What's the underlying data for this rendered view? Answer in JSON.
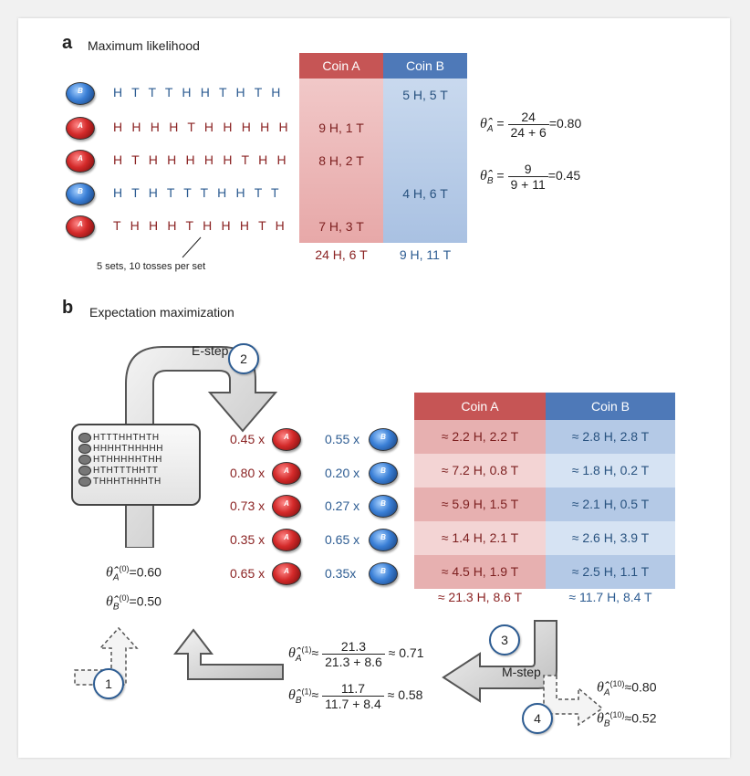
{
  "panel_a": {
    "letter": "a",
    "title": "Maximum likelihood",
    "rows": [
      {
        "coin": "B",
        "sequence": "H T T T H H T H T H",
        "coin_a": "",
        "coin_b": "5 H, 5 T"
      },
      {
        "coin": "A",
        "sequence": "H H H H T H H H H H",
        "coin_a": "9 H, 1 T",
        "coin_b": ""
      },
      {
        "coin": "A",
        "sequence": "H T H H H H H T H H",
        "coin_a": "8 H, 2 T",
        "coin_b": ""
      },
      {
        "coin": "B",
        "sequence": "H T H T T T H H T T",
        "coin_a": "",
        "coin_b": "4 H, 6 T"
      },
      {
        "coin": "A",
        "sequence": "T H H H T H H H T H",
        "coin_a": "7 H, 3 T",
        "coin_b": ""
      }
    ],
    "table_header_a": "Coin A",
    "table_header_b": "Coin B",
    "total_a": "24 H, 6 T",
    "total_b": "9 H, 11 T",
    "caption": "5 sets, 10 tosses per set",
    "eq_a": {
      "lhs_sub": "A",
      "num": "24",
      "den": "24 + 6",
      "result": "=0.80"
    },
    "eq_b": {
      "lhs_sub": "B",
      "num": "9",
      "den": "9 + 11",
      "result": "=0.45"
    }
  },
  "panel_b": {
    "letter": "b",
    "title": "Expectation maximization",
    "estep_label": "E-step",
    "mstep_label": "M-step",
    "steps": [
      "1",
      "2",
      "3",
      "4"
    ],
    "mini_sequences": [
      "HTTTHHTHTH",
      "HHHHTHHHHH",
      "HTHHHHHTHH",
      "HTHTTTHHTT",
      "THHHTHHHTH"
    ],
    "weights": [
      {
        "a": "0.45 x",
        "b": "0.55 x"
      },
      {
        "a": "0.80 x",
        "b": "0.20 x"
      },
      {
        "a": "0.73 x",
        "b": "0.27 x"
      },
      {
        "a": "0.35 x",
        "b": "0.65 x"
      },
      {
        "a": "0.65 x",
        "b": "0.35x"
      }
    ],
    "table_header_a": "Coin A",
    "table_header_b": "Coin B",
    "table_rows": [
      {
        "a": "≈ 2.2 H, 2.2 T",
        "b": "≈ 2.8 H, 2.8 T"
      },
      {
        "a": "≈ 7.2 H, 0.8 T",
        "b": "≈ 1.8 H, 0.2 T"
      },
      {
        "a": "≈ 5.9 H, 1.5 T",
        "b": "≈ 2.1 H, 0.5 T"
      },
      {
        "a": "≈ 1.4 H, 2.1 T",
        "b": "≈ 2.6 H, 3.9 T"
      },
      {
        "a": "≈ 4.5 H, 1.9 T",
        "b": "≈ 2.5 H, 1.1 T"
      }
    ],
    "total_a": "≈ 21.3 H, 8.6 T",
    "total_b": "≈ 11.7 H, 8.4 T",
    "init_a": {
      "sub": "A",
      "sup": "(0)",
      "value": "=0.60"
    },
    "init_b": {
      "sub": "B",
      "sup": "(0)",
      "value": "=0.50"
    },
    "update_a": {
      "sub": "A",
      "sup": "(1)",
      "approx": "≈",
      "num": "21.3",
      "den": "21.3 + 8.6",
      "result": "≈ 0.71"
    },
    "update_b": {
      "sub": "B",
      "sup": "(1)",
      "approx": "≈",
      "num": "11.7",
      "den": "11.7 + 8.4",
      "result": "≈ 0.58"
    },
    "final_a": {
      "sub": "A",
      "sup": "(10)",
      "value": "≈0.80"
    },
    "final_b": {
      "sub": "B",
      "sup": "(10)",
      "value": "≈0.52"
    }
  },
  "colors": {
    "coin_a": "#c65555",
    "coin_b": "#4e79b8",
    "coin_a_text": "#8b2323",
    "coin_b_text": "#2d5c92"
  }
}
